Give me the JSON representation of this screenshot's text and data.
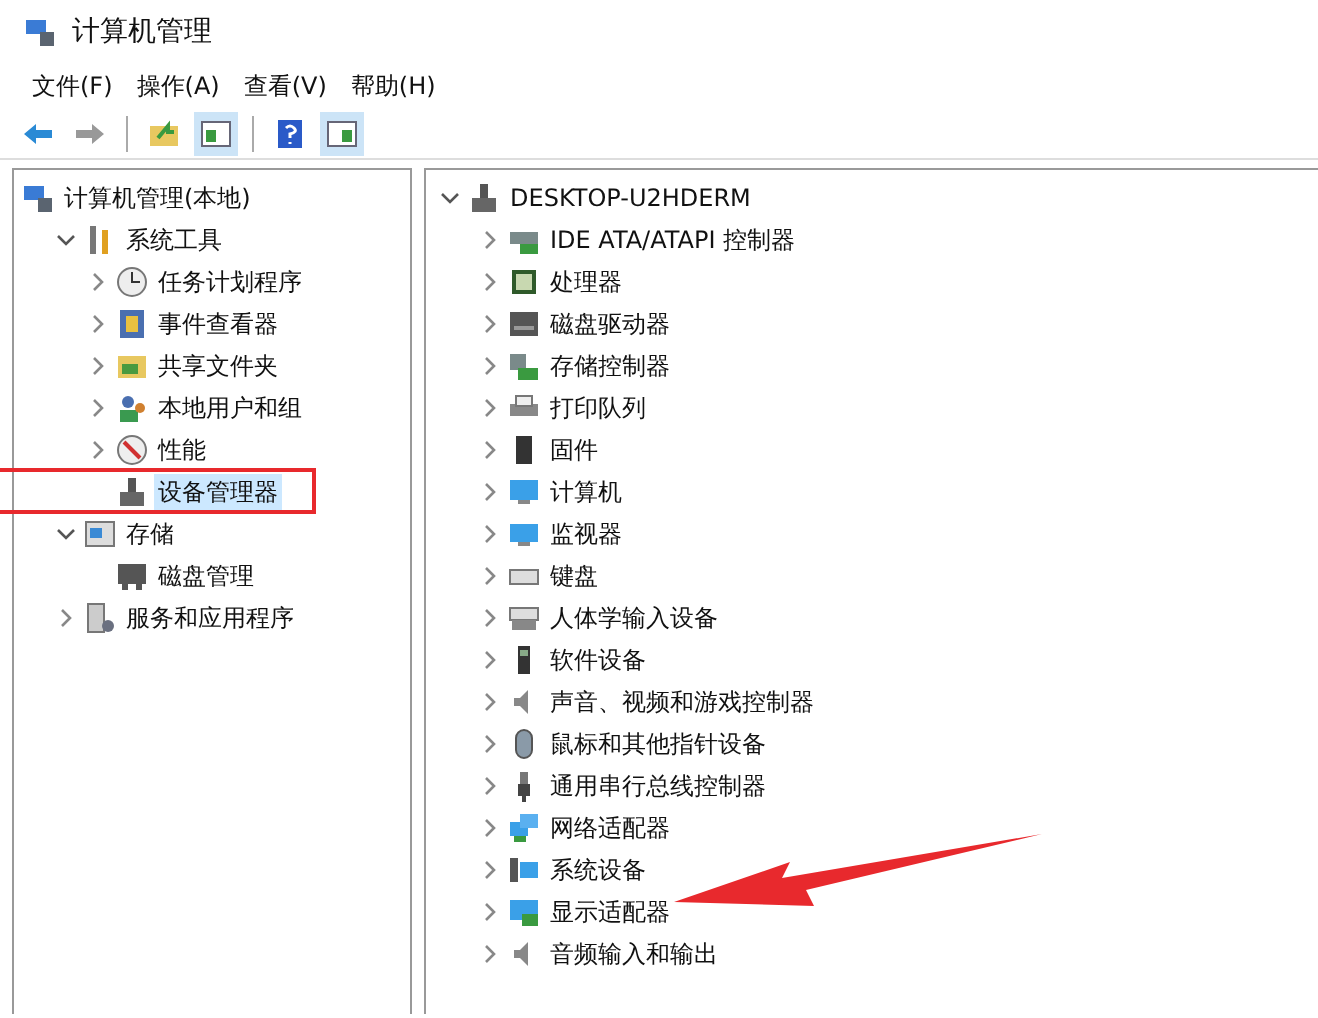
{
  "window": {
    "title": "计算机管理"
  },
  "menu": [
    "文件(F)",
    "操作(A)",
    "查看(V)",
    "帮助(H)"
  ],
  "left_tree": [
    {
      "label": "计算机管理(本地)",
      "children": [
        {
          "label": "系统工具",
          "expanded": true,
          "children": [
            {
              "label": "任务计划程序",
              "expanded": false,
              "has_children": true
            },
            {
              "label": "事件查看器",
              "expanded": false,
              "has_children": true
            },
            {
              "label": "共享文件夹",
              "expanded": false,
              "has_children": true
            },
            {
              "label": "本地用户和组",
              "expanded": false,
              "has_children": true
            },
            {
              "label": "性能",
              "expanded": false,
              "has_children": true
            },
            {
              "label": "设备管理器",
              "expanded": false,
              "has_children": false,
              "selected": true,
              "circled": true
            }
          ]
        },
        {
          "label": "存储",
          "expanded": true,
          "children": [
            {
              "label": "磁盘管理",
              "expanded": false,
              "has_children": false
            }
          ]
        },
        {
          "label": "服务和应用程序",
          "expanded": false,
          "has_children": true
        }
      ]
    }
  ],
  "device_tree": {
    "label": "DESKTOP-U2HDERM",
    "expanded": true,
    "children": [
      {
        "label": "IDE ATA/ATAPI 控制器"
      },
      {
        "label": "处理器"
      },
      {
        "label": "磁盘驱动器"
      },
      {
        "label": "存储控制器"
      },
      {
        "label": "打印队列"
      },
      {
        "label": "固件"
      },
      {
        "label": "计算机"
      },
      {
        "label": "监视器"
      },
      {
        "label": "键盘"
      },
      {
        "label": "人体学输入设备"
      },
      {
        "label": "软件设备"
      },
      {
        "label": "声音、视频和游戏控制器"
      },
      {
        "label": "鼠标和其他指针设备"
      },
      {
        "label": "通用串行总线控制器"
      },
      {
        "label": "网络适配器"
      },
      {
        "label": "系统设备"
      },
      {
        "label": "显示适配器",
        "pointed": true
      },
      {
        "label": "音频输入和输出"
      }
    ]
  }
}
